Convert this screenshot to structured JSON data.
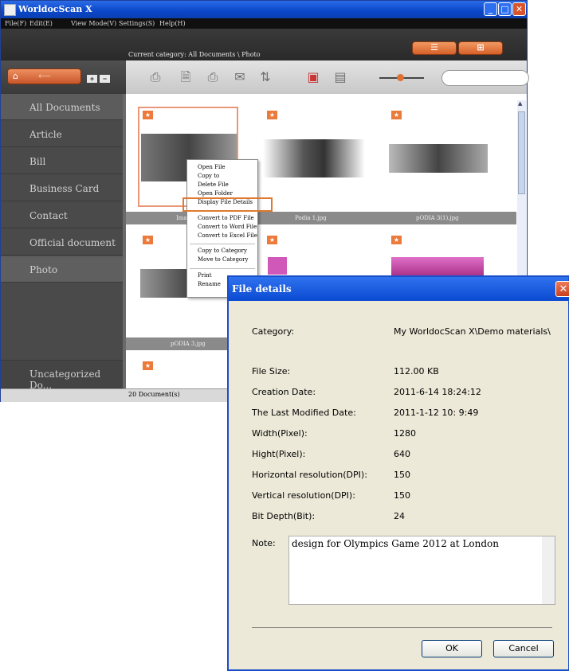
{
  "app": {
    "title": "WorldocScan X",
    "menu": [
      "File(F)",
      "Edit(E)",
      "View Mode(V)",
      "Settings(S)",
      "Help(H)"
    ],
    "current_category_label": "Current category:  All Documents \\ Photo",
    "status": "20 Document(s)"
  },
  "sidebar": {
    "items": [
      "All Documents",
      "Article",
      "Bill",
      "Business Card",
      "Contact",
      "Official document",
      "Photo"
    ],
    "uncategorized": "Uncategorized Do..."
  },
  "files": [
    {
      "caption": "Imag"
    },
    {
      "caption": "Podia 1.jpg"
    },
    {
      "caption": "pODIA 3(1).jpg"
    },
    {
      "caption": "pODIA 3.jpg"
    }
  ],
  "context_menu": {
    "group1": [
      "Open File",
      "Copy to",
      "Delete File",
      "Open Folder",
      "Display File Details"
    ],
    "group2": [
      "Convert to PDF File",
      "Convert to Word File",
      "Convert to Excel File"
    ],
    "group3": [
      "Copy to Category",
      "Move to Category"
    ],
    "group4": [
      "Print",
      "Rename"
    ]
  },
  "dialog": {
    "title": "File details",
    "category_label": "Category:",
    "category_value": "My WorldocScan X\\Demo materials\\",
    "fields": [
      {
        "label": "File Size:",
        "value": "112.00 KB"
      },
      {
        "label": "Creation Date:",
        "value": "2011-6-14  18:24:12"
      },
      {
        "label": "The Last Modified Date:",
        "value": "2011-1-12  10: 9:49"
      },
      {
        "label": "Width(Pixel):",
        "value": "1280"
      },
      {
        "label": "Hight(Pixel):",
        "value": "640"
      },
      {
        "label": "Horizontal resolution(DPI):",
        "value": "150"
      },
      {
        "label": "Vertical resolution(DPI):",
        "value": "150"
      },
      {
        "label": "Bit Depth(Bit):",
        "value": "24"
      }
    ],
    "note_label": "Note:",
    "note_value": "design for Olympics Game 2012 at London",
    "ok_label": "OK",
    "cancel_label": "Cancel"
  }
}
